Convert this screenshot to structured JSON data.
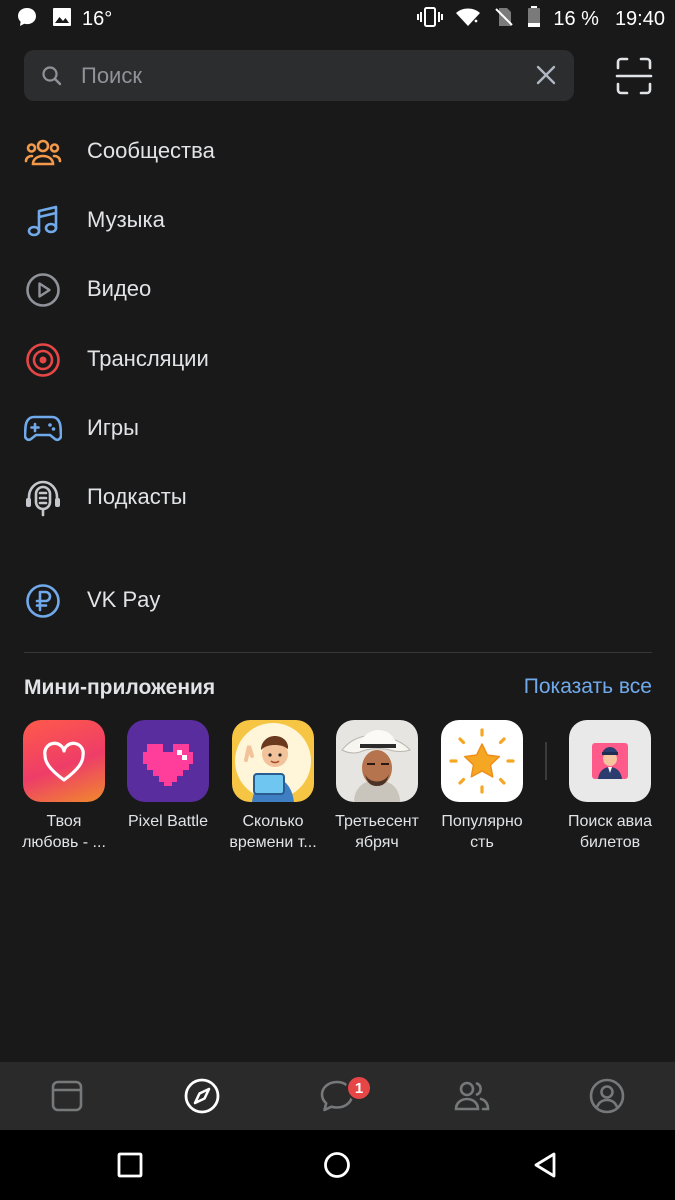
{
  "status_bar": {
    "temperature": "16°",
    "battery": "16 %",
    "time": "19:40",
    "icons": [
      "chat-notification-icon",
      "image-notification-icon",
      "vibrate-icon",
      "wifi-icon",
      "no-sim-icon",
      "battery-icon"
    ]
  },
  "search": {
    "placeholder": "Поиск",
    "value": ""
  },
  "menu": {
    "items": [
      {
        "label": "Сообщества",
        "icon": "communities-icon",
        "color": "#f2994a"
      },
      {
        "label": "Музыка",
        "icon": "music-note-icon",
        "color": "#71aaeb"
      },
      {
        "label": "Видео",
        "icon": "play-circle-icon",
        "color": "#8f9399"
      },
      {
        "label": "Трансляции",
        "icon": "broadcast-icon",
        "color": "#e64646"
      },
      {
        "label": "Игры",
        "icon": "gamepad-icon",
        "color": "#71aaeb"
      },
      {
        "label": "Подкасты",
        "icon": "podcast-icon",
        "color": "#c4c8cc"
      },
      {
        "label": "VK Pay",
        "icon": "ruble-coin-icon",
        "color": "#71aaeb"
      }
    ]
  },
  "mini_apps": {
    "title": "Мини-приложения",
    "show_all": "Показать все",
    "items": [
      {
        "label": "Твоя\nлюбовь - ...",
        "icon": "heart-icon"
      },
      {
        "label": "Pixel Battle",
        "icon": "pixel-heart-icon"
      },
      {
        "label": "Сколько\nвремени т...",
        "icon": "cartoon-boy-icon"
      },
      {
        "label": "Третьесент\nябряч",
        "icon": "singer-photo-icon"
      },
      {
        "label": "Популярно\nсть",
        "icon": "star-icon"
      },
      {
        "label": "Поиск авиа\nбилетов",
        "icon": "pilot-icon"
      }
    ]
  },
  "tab_bar": {
    "tabs": [
      "news-tab-icon",
      "explore-compass-icon",
      "messages-icon",
      "friends-icon",
      "profile-icon"
    ],
    "messages_badge": "1",
    "active_color": "#ffffff",
    "inactive_color": "#76787a"
  },
  "colors": {
    "background": "#19191a",
    "accent": "#71aaeb",
    "badge": "#e64646"
  }
}
